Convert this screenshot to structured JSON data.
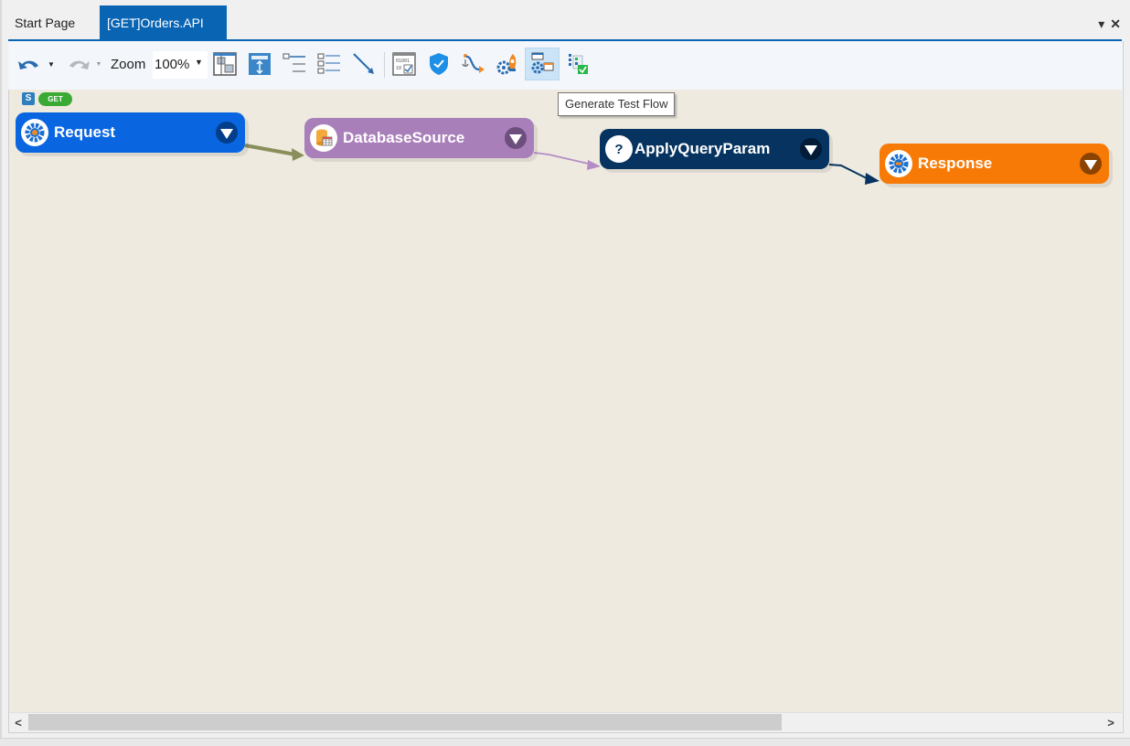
{
  "tabs": [
    {
      "label": "Start Page",
      "active": false
    },
    {
      "label": "[GET]Orders.API",
      "active": true
    }
  ],
  "tab_actions": {
    "dropdown": "▾",
    "close": "✕"
  },
  "toolbar": {
    "zoom_label": "Zoom",
    "zoom_value": "100%",
    "buttons": [
      {
        "name": "undo",
        "icon": "undo-icon"
      },
      {
        "name": "redo",
        "icon": "redo-icon"
      },
      {
        "name": "horizontal-layout",
        "icon": "layout-horizontal-icon"
      },
      {
        "name": "vertical-layout",
        "icon": "layout-vertical-icon"
      },
      {
        "name": "collapse-all",
        "icon": "collapse-list-icon"
      },
      {
        "name": "expand-all",
        "icon": "expand-list-icon"
      },
      {
        "name": "connector",
        "icon": "connector-line-icon"
      },
      {
        "name": "binary-data",
        "icon": "binary-check-icon"
      },
      {
        "name": "security",
        "icon": "shield-check-icon"
      },
      {
        "name": "trace-flow",
        "icon": "anchor-flow-icon"
      },
      {
        "name": "deploy",
        "icon": "gear-rocket-icon"
      },
      {
        "name": "generate-test-flow",
        "icon": "gear-window-icon",
        "hovered": true
      },
      {
        "name": "test-report",
        "icon": "checklist-icon"
      }
    ]
  },
  "tooltip": "Generate Test Flow",
  "canvas": {
    "badges": {
      "s": "S",
      "method": "GET"
    },
    "nodes": [
      {
        "label": "Request",
        "color": "#0a66e0",
        "icon": "gear-icon"
      },
      {
        "label": "DatabaseSource",
        "color": "#a97fba",
        "icon": "database-table-icon"
      },
      {
        "label": "ApplyQueryParam",
        "color": "#06335f",
        "icon": "question-icon"
      },
      {
        "label": "Response",
        "color": "#f77a06",
        "icon": "gear-icon"
      }
    ],
    "edges": [
      {
        "from": "Request",
        "to": "DatabaseSource",
        "color": "#8a8f5a"
      },
      {
        "from": "DatabaseSource",
        "to": "ApplyQueryParam",
        "color": "#b48cc4"
      },
      {
        "from": "ApplyQueryParam",
        "to": "Response",
        "color": "#06335f"
      }
    ]
  },
  "scrollbar": {
    "left_arrow": "<",
    "right_arrow": ">"
  }
}
